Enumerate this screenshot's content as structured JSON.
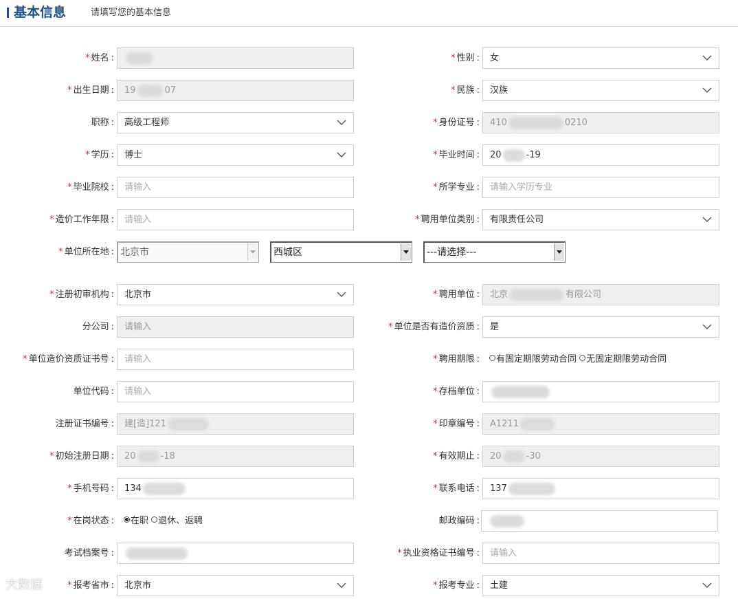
{
  "header": {
    "title": "基本信息",
    "subtitle": "请填写您的基本信息"
  },
  "form": {
    "name_label": "姓名",
    "gender_label": "性别",
    "gender_value": "女",
    "birth_label": "出生日期",
    "birth_prefix": "19",
    "birth_suffix": "07",
    "ethnic_label": "民族",
    "ethnic_value": "汉族",
    "title_label": "职称",
    "title_value": "高级工程师",
    "id_label": "身份证号",
    "id_prefix": "410",
    "id_suffix": "0210",
    "edu_label": "学历",
    "edu_value": "博士",
    "grad_time_label": "毕业时间",
    "grad_prefix": "20",
    "grad_suffix": "-19",
    "school_label": "毕业院校",
    "school_placeholder": "请输入",
    "major_label": "所学专业",
    "major_placeholder": "请输入学历专业",
    "years_label": "造价工作年限",
    "years_placeholder": "请输入",
    "employer_type_label": "聘用单位类别",
    "employer_type_value": "有限责任公司",
    "location_label": "单位所在地",
    "province_value": "北京市",
    "district_value": "西城区",
    "street_value": "---请选择---",
    "reg_org_label": "注册初审机构",
    "reg_org_value": "北京市",
    "employer_label": "聘用单位",
    "employer_prefix": "北京",
    "employer_suffix": "有限公司",
    "branch_label": "分公司",
    "branch_placeholder": "请输入",
    "qual_label": "单位是否有造价资质",
    "qual_value": "是",
    "qual_cert_label": "单位造价资质证书号",
    "qual_cert_placeholder": "请输入",
    "term_label": "聘用期限",
    "term_opt1": "有固定期限劳动合同",
    "term_opt2": "无固定期限劳动合同",
    "unit_code_label": "单位代码",
    "unit_code_placeholder": "请输入",
    "archive_label": "存档单位",
    "reg_cert_label": "注册证书编号",
    "reg_cert_prefix": "建[造]121",
    "seal_label": "印章编号",
    "seal_prefix": "A1211",
    "init_reg_label": "初始注册日期",
    "init_reg_prefix": "20",
    "init_reg_suffix": "-18",
    "expiry_label": "有效期止",
    "expiry_prefix": "20",
    "expiry_suffix": "-30",
    "mobile_label": "手机号码",
    "mobile_prefix": "134",
    "phone_label": "联系电话",
    "phone_prefix": "137",
    "status_label": "在岗状态",
    "status_opt1": "在职",
    "status_opt2": "退休、返聘",
    "postal_label": "邮政编码",
    "exam_label": "考试档案号",
    "license_label": "执业资格证书编号",
    "license_placeholder": "请输入",
    "city_label": "报考省市",
    "city_value": "北京市",
    "spec_label": "报考专业",
    "spec_value": "土建"
  },
  "watermark": "大数据"
}
